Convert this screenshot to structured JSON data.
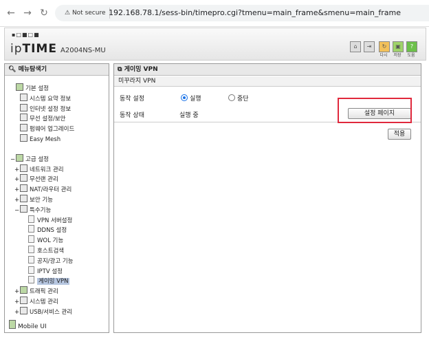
{
  "browser": {
    "security": "Not secure",
    "url": "192.168.78.1/sess-bin/timepro.cgi?tmenu=main_frame&smenu=main_frame"
  },
  "header": {
    "logo_prefix": "ip",
    "logo_brand": "TIME",
    "model": "A2004NS-MU",
    "buttons": [
      {
        "label": "다시"
      },
      {
        "label": "저장"
      },
      {
        "label": "도움"
      }
    ]
  },
  "sidebar": {
    "title": "메뉴탐색기",
    "basic": {
      "label": "기본 설정",
      "items": [
        "시스템 요약 정보",
        "인터넷 설정 정보",
        "무선 설정/보안",
        "펌웨어 업그레이드",
        "Easy Mesh"
      ]
    },
    "advanced": {
      "label": "고급 설정",
      "items": [
        "네트워크 관리",
        "무선랜 관리",
        "NAT/라우터 관리",
        "보안 기능"
      ],
      "special": {
        "label": "특수기능",
        "items": [
          "VPN 서버설정",
          "DDNS 설정",
          "WOL 기능",
          "호스트검색",
          "공지/광고 기능",
          "IPTV 설정",
          "게이밍 VPN"
        ]
      },
      "after": [
        "트래픽 관리",
        "시스템 관리",
        "USB/서비스 관리"
      ]
    },
    "mobile": "Mobile UI"
  },
  "content": {
    "title": "게이밍 VPN",
    "subtitle": "미꾸라지 VPN",
    "operation_label": "동작 설정",
    "run_label": "실행",
    "stop_label": "중단",
    "status_label": "동작 상태",
    "status_value": "실행 중",
    "settings_button": "설정 페이지",
    "apply_button": "적용"
  }
}
